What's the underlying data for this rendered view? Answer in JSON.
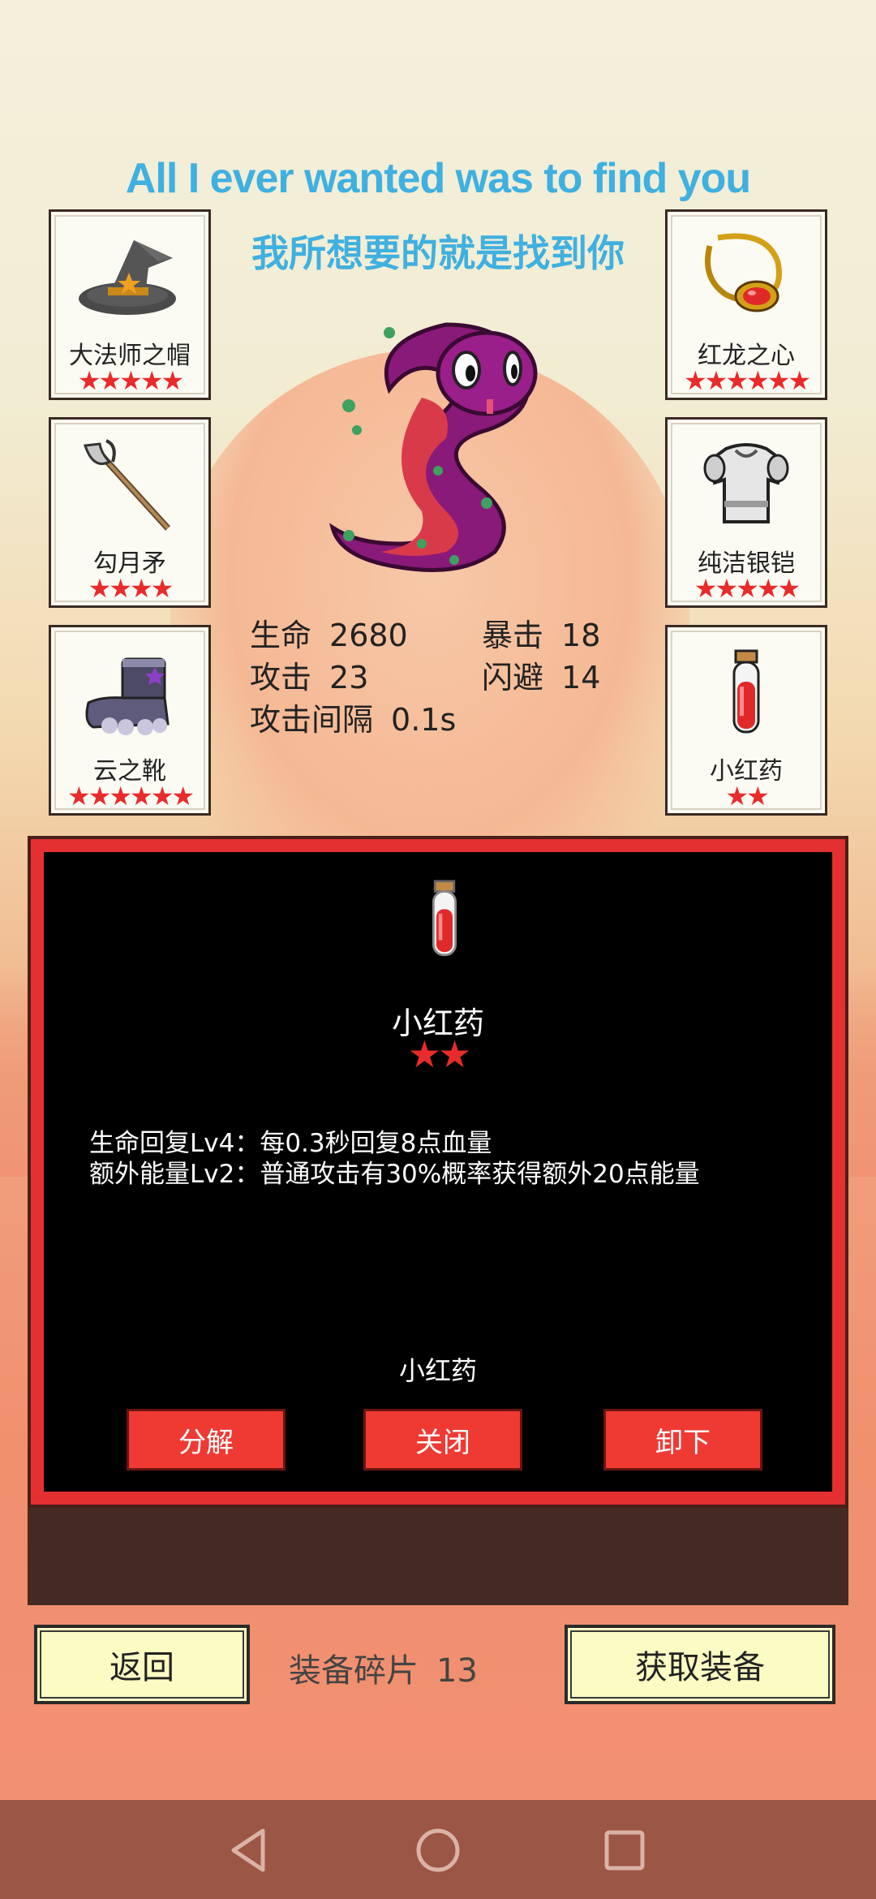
{
  "lyrics": {
    "english": "All I ever wanted was to find you",
    "chinese": "我所想要的就是找到你"
  },
  "equipment": {
    "left": [
      {
        "name": "大法师之帽",
        "stars": "★★★★★",
        "icon": "wizard-hat-icon"
      },
      {
        "name": "勾月矛",
        "stars": "★★★★",
        "icon": "crescent-spear-icon"
      },
      {
        "name": "云之靴",
        "stars": "★★★★★★",
        "icon": "cloud-boots-icon"
      }
    ],
    "right": [
      {
        "name": "红龙之心",
        "stars": "★★★★★★",
        "icon": "red-dragon-heart-amulet-icon"
      },
      {
        "name": "纯洁银铠",
        "stars": "★★★★★",
        "icon": "silver-armor-icon"
      },
      {
        "name": "小红药",
        "stars": "★★",
        "icon": "red-potion-icon"
      }
    ]
  },
  "stats": {
    "hp_label": "生命",
    "hp_value": "2680",
    "crit_label": "暴击",
    "crit_value": "18",
    "atk_label": "攻击",
    "atk_value": "23",
    "dodge_label": "闪避",
    "dodge_value": "14",
    "interval_label": "攻击间隔",
    "interval_value": "0.1s"
  },
  "detail": {
    "icon": "red-potion-icon",
    "name": "小红药",
    "stars": "★★",
    "skills": [
      "生命回复Lv4：每0.3秒回复8点血量",
      "额外能量Lv2：普通攻击有30%概率获得额外20点能量"
    ],
    "footer_name": "小红药",
    "buttons": {
      "decompose": "分解",
      "close": "关闭",
      "unequip": "卸下"
    }
  },
  "bottom": {
    "back": "返回",
    "fragments_label": "装备碎片",
    "fragments_value": "13",
    "get_equipment": "获取装备"
  },
  "colors": {
    "lyric": "#3fb0e0",
    "star": "#e82b2b",
    "red_button": "#ef3a34",
    "yellow_button": "#fbfbc3",
    "navbar": "#9c5646"
  }
}
